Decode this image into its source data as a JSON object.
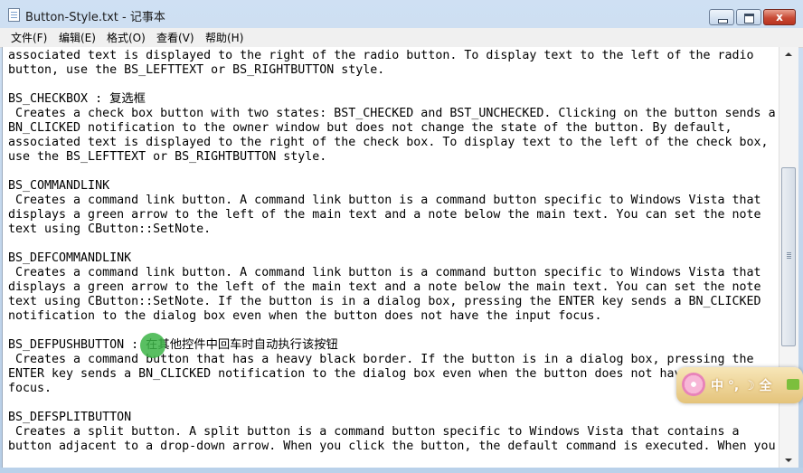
{
  "window": {
    "title": "Button-Style.txt - 记事本",
    "controls": {
      "minimize": "",
      "maximize": "",
      "close": "x"
    }
  },
  "menu": [
    {
      "label": "文件(F)"
    },
    {
      "label": "编辑(E)"
    },
    {
      "label": "格式(O)"
    },
    {
      "label": "查看(V)"
    },
    {
      "label": "帮助(H)"
    }
  ],
  "document": {
    "lines": [
      "associated text is displayed to the right of the radio button. To display text to the left of the radio",
      "button, use the BS_LEFTTEXT or BS_RIGHTBUTTON style.",
      "",
      "BS_CHECKBOX : 复选框",
      " Creates a check box button with two states: BST_CHECKED and BST_UNCHECKED. Clicking on the button sends a",
      "BN_CLICKED notification to the owner window but does not change the state of the button. By default,",
      "associated text is displayed to the right of the check box. To display text to the left of the check box,",
      "use the BS_LEFTTEXT or BS_RIGHTBUTTON style.",
      "",
      "BS_COMMANDLINK",
      " Creates a command link button. A command link button is a command button specific to Windows Vista that",
      "displays a green arrow to the left of the main text and a note below the main text. You can set the note",
      "text using CButton::SetNote.",
      "",
      "BS_DEFCOMMANDLINK",
      " Creates a command link button. A command link button is a command button specific to Windows Vista that",
      "displays a green arrow to the left of the main text and a note below the main text. You can set the note",
      "text using CButton::SetNote. If the button is in a dialog box, pressing the ENTER key sends a BN_CLICKED",
      "notification to the dialog box even when the button does not have the input focus.",
      "",
      "BS_DEFPUSHBUTTON : 在其他控件中回车时自动执行该按钮",
      " Creates a command button that has a heavy black border. If the button is in a dialog box, pressing the",
      "ENTER key sends a BN_CLICKED notification to the dialog box even when the button does not have the input",
      "focus.",
      "",
      "BS_DEFSPLITBUTTON",
      " Creates a split button. A split button is a command button specific to Windows Vista that contains a",
      "button adjacent to a drop-down arrow. When you click the button, the default command is executed. When you"
    ]
  },
  "overlay_widget": {
    "label": "中 °, ☽ 全"
  }
}
